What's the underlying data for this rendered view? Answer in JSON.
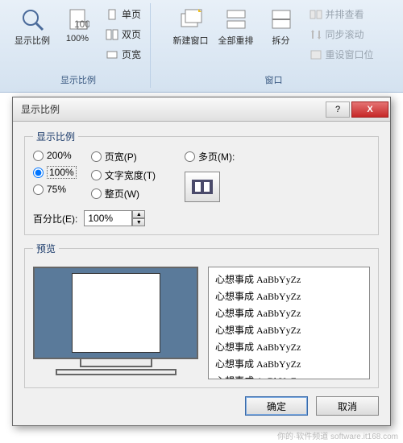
{
  "ribbon": {
    "zoom_group_label": "显示比例",
    "window_group_label": "窗口",
    "zoom_btn": "显示比例",
    "pct_btn": "100%",
    "one_page": "单页",
    "two_page": "双页",
    "page_width": "页宽",
    "new_window": "新建窗口",
    "arrange_all": "全部重排",
    "split": "拆分",
    "side_by_side": "并排查看",
    "sync_scroll": "同步滚动",
    "reset_window": "重设窗口位"
  },
  "dialog": {
    "title": "显示比例",
    "group_label": "显示比例",
    "r200": "200%",
    "r100": "100%",
    "r75": "75%",
    "page_width": "页宽(P)",
    "text_width": "文字宽度(T)",
    "whole_page": "整页(W)",
    "multi_page": "多页(M):",
    "percent_label": "百分比(E):",
    "percent_value": "100%",
    "preview_label": "预览",
    "sample_line": "心想事成 AaBbYyZz",
    "ok": "确定",
    "cancel": "取消"
  },
  "watermark": "你的·软件频道 software.it168.com"
}
